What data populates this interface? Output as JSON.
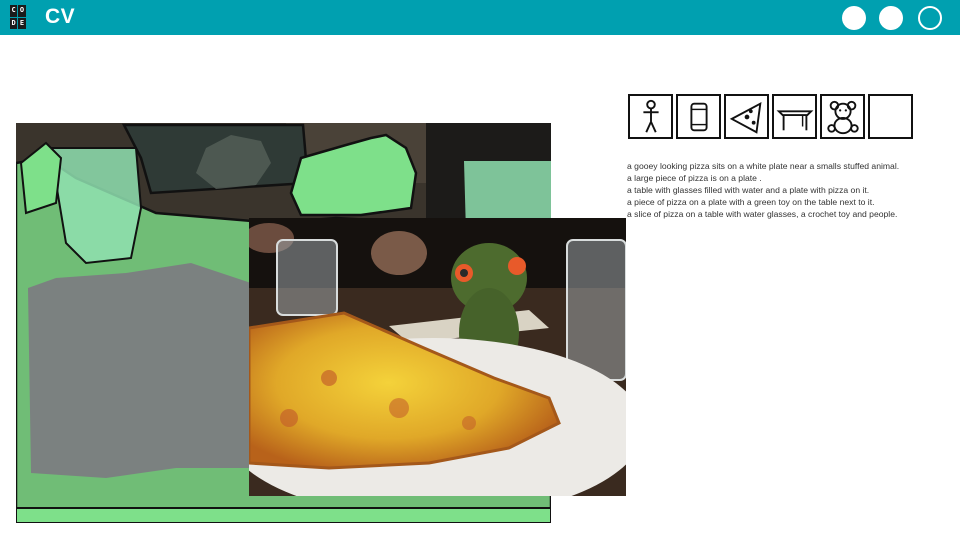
{
  "header": {
    "logo_letters": [
      "C",
      "O",
      "D",
      "E"
    ],
    "title": "CV",
    "background_color": "#00a0b0",
    "nav_dots": [
      {
        "name": "nav-dot-1",
        "filled": true
      },
      {
        "name": "nav-dot-2",
        "filled": true
      },
      {
        "name": "nav-dot-3",
        "filled": false
      }
    ]
  },
  "segmentation": {
    "overlay_color": "#7ee08a",
    "region_labels": [
      "person",
      "cup",
      "pizza",
      "dining-table",
      "teddy-bear"
    ]
  },
  "object_icons": [
    {
      "name": "person-icon"
    },
    {
      "name": "cup-icon"
    },
    {
      "name": "pizza-icon"
    },
    {
      "name": "table-icon"
    },
    {
      "name": "teddy-bear-icon"
    },
    {
      "name": "empty-icon-slot"
    }
  ],
  "captions": [
    "a gooey looking pizza sits on a white plate near a smalls stuffed animal.",
    "a large piece of pizza is on a plate .",
    "a table with glasses filled with water and a plate with pizza on it.",
    "a piece of pizza on a plate with a green toy on the table next to it.",
    "a slice of pizza on a table with water glasses, a crochet toy and people."
  ]
}
